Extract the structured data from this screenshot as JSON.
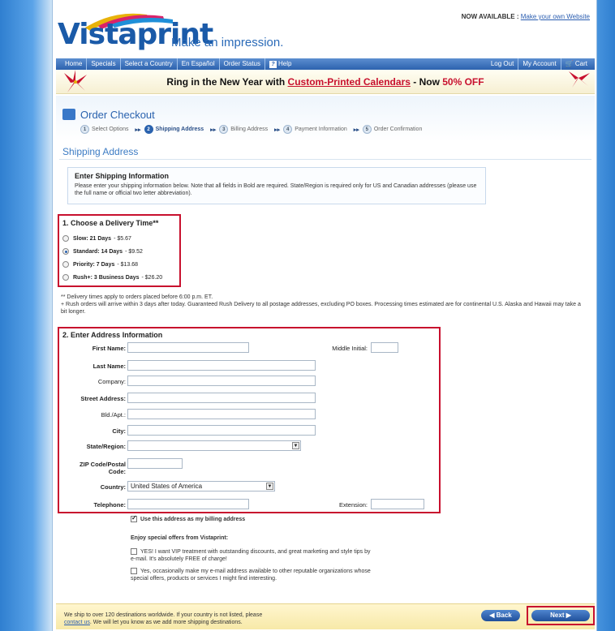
{
  "header": {
    "logo_text": "Vistaprint",
    "tagline": "Make an impression.",
    "now_available_label": "NOW AVAILABLE :",
    "now_available_link": "Make your own Website"
  },
  "nav": {
    "left": [
      "Home",
      "Specials",
      "Select a Country",
      "En Español",
      "Order Status",
      "Help"
    ],
    "right": [
      "Log Out",
      "My Account",
      "Cart"
    ]
  },
  "banner": {
    "prefix": "Ring in the New Year with ",
    "link": "Custom-Printed Calendars",
    "middle": " - Now ",
    "discount": "50% OFF"
  },
  "checkout": {
    "title": "Order Checkout",
    "steps": [
      {
        "num": "1",
        "label": "Select Options"
      },
      {
        "num": "2",
        "label": "Shipping Address"
      },
      {
        "num": "3",
        "label": "Billing Address"
      },
      {
        "num": "4",
        "label": "Payment Information"
      },
      {
        "num": "5",
        "label": "Order Confirmation"
      }
    ],
    "active_step": 2
  },
  "section_heading": "Shipping Address",
  "info": {
    "title": "Enter Shipping Information",
    "text": "Please enter your shipping information below. Note that all fields in Bold are required. State/Region is required only for US and Canadian addresses (please use the full name or official two letter abbreviation)."
  },
  "delivery": {
    "title": "1. Choose a Delivery Time**",
    "options": [
      {
        "name": "Slow: 21 Days",
        "price": "- $5.67",
        "selected": false
      },
      {
        "name": "Standard: 14 Days",
        "price": "- $9.52",
        "selected": true
      },
      {
        "name": "Priority: 7 Days",
        "price": "- $13.68",
        "selected": false
      },
      {
        "name": "Rush+: 3 Business Days",
        "price": "- $26.20",
        "selected": false
      }
    ],
    "note1": "** Delivery times apply to orders placed before 6:00 p.m. ET.",
    "note2": "+ Rush orders will arrive within 3 days after today. Guaranteed Rush Delivery to all postage addresses, excluding PO boxes. Processing times estimated are for continental U.S. Alaska and Hawaii may take a bit longer."
  },
  "address": {
    "title": "2. Enter Address Information",
    "first_name": "First Name:",
    "middle_initial": "Middle Initial:",
    "last_name": "Last Name:",
    "company": "Company:",
    "street": "Street Address:",
    "bld": "Bld./Apt.:",
    "city": "City:",
    "state": "State/Region:",
    "zip": "ZIP Code/Postal Code:",
    "country": "Country:",
    "country_value": "United States of America",
    "telephone": "Telephone:",
    "extension": "Extension:"
  },
  "billing": {
    "use_as_billing": "Use this address as my billing address",
    "offers_title": "Enjoy special offers from Vistaprint:",
    "offer1": "YES! I want VIP treatment with outstanding discounts, and great marketing and style tips by e-mail. It's absolutely FREE of charge!",
    "offer2": "Yes, occasionally make my e-mail address available to other reputable organizations whose special offers, products or services I might find interesting."
  },
  "footer": {
    "text1": "We ship to over 120 destinations worldwide. If your country is not listed, please",
    "link": "contact us",
    "text2": ". We will let you know as we add more shipping destinations.",
    "back": "Back",
    "next": "Next"
  }
}
